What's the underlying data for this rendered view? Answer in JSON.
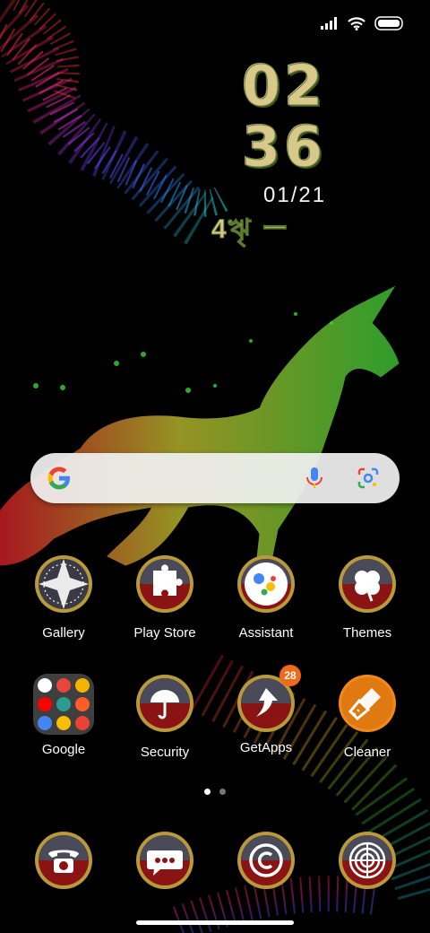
{
  "clock": {
    "hour": "02",
    "minute": "36",
    "date": "01/21",
    "weekday": "4ৠ ー"
  },
  "search": {
    "logo_letter": "G"
  },
  "apps_row1": [
    {
      "label": "Gallery",
      "icon": "gallery-icon"
    },
    {
      "label": "Play Store",
      "icon": "play-store-icon"
    },
    {
      "label": "Assistant",
      "icon": "assistant-icon"
    },
    {
      "label": "Themes",
      "icon": "themes-icon"
    }
  ],
  "apps_row2": [
    {
      "label": "Google",
      "icon": "google-folder-icon"
    },
    {
      "label": "Security",
      "icon": "security-icon"
    },
    {
      "label": "GetApps",
      "icon": "getapps-icon",
      "badge": "28"
    },
    {
      "label": "Cleaner",
      "icon": "cleaner-icon"
    }
  ],
  "dock": [
    {
      "icon": "phone-icon"
    },
    {
      "icon": "messages-icon"
    },
    {
      "icon": "copyright-icon"
    },
    {
      "icon": "camera-icon"
    }
  ],
  "colors": {
    "badge": "#f06a1a",
    "search_bg": "#f0f0f0",
    "folder_bg": "#464646"
  }
}
